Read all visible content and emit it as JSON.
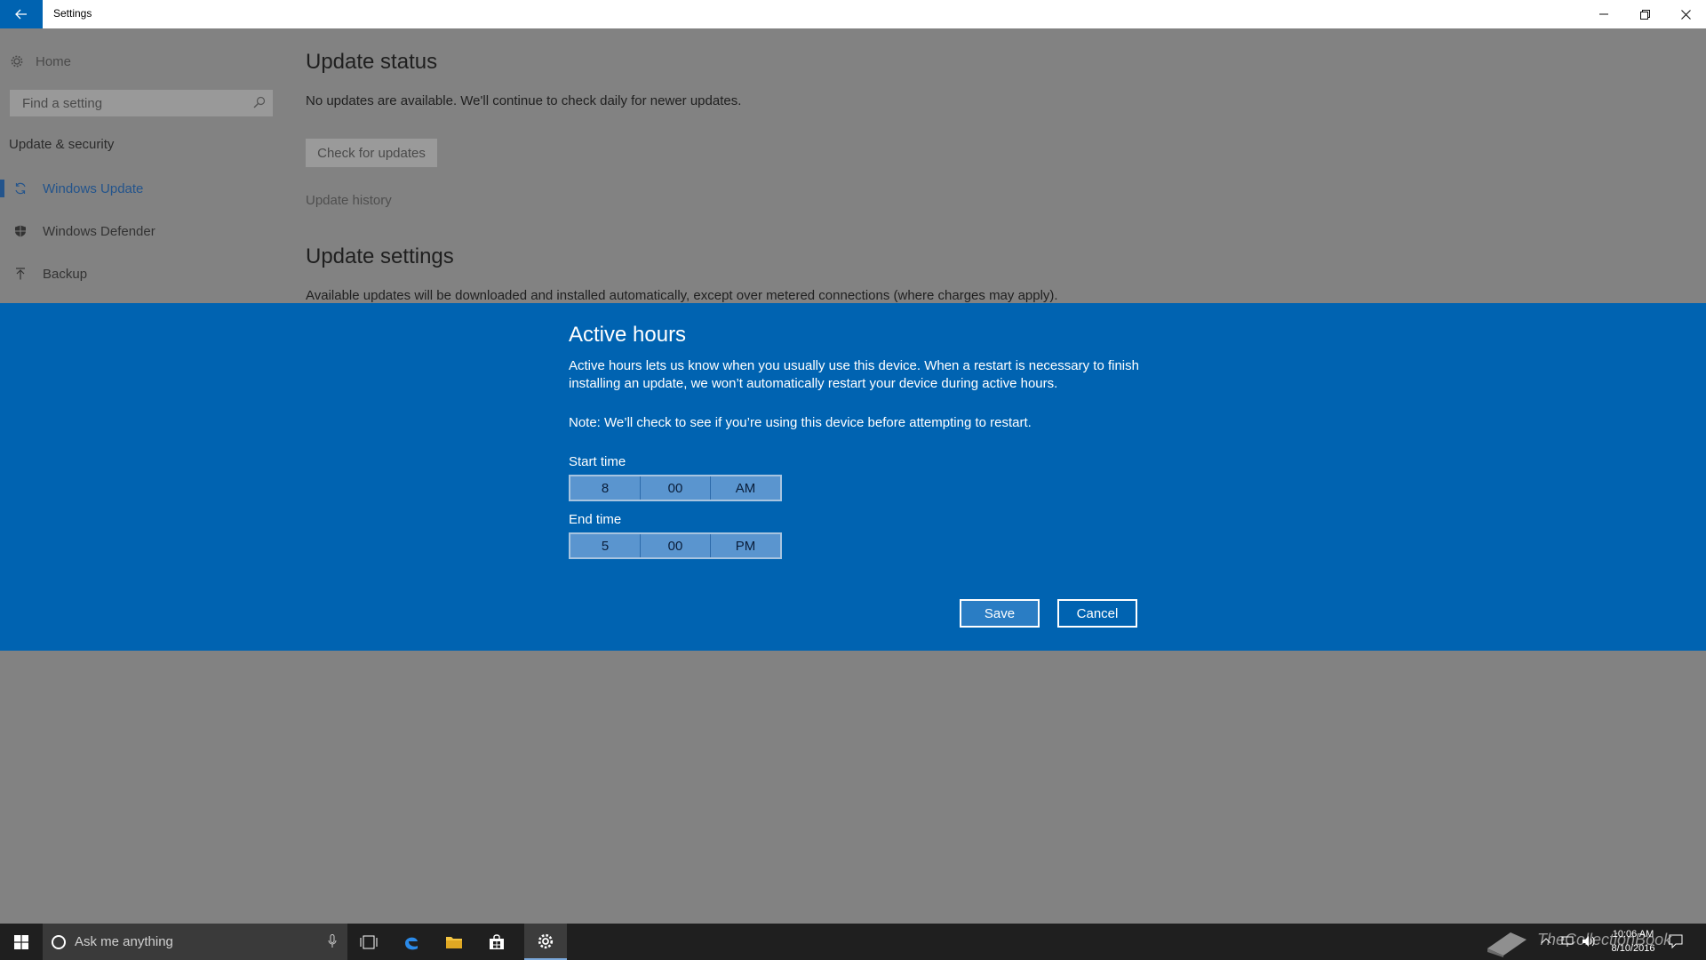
{
  "window": {
    "title": "Settings"
  },
  "sidebar": {
    "home_label": "Home",
    "search_placeholder": "Find a setting",
    "section_title": "Update & security",
    "items": [
      {
        "label": "Windows Update",
        "icon": "sync-icon",
        "active": true
      },
      {
        "label": "Windows Defender",
        "icon": "shield-icon",
        "active": false
      },
      {
        "label": "Backup",
        "icon": "upload-icon",
        "active": false
      }
    ]
  },
  "main": {
    "update_status_title": "Update status",
    "update_status_text": "No updates are available. We'll continue to check daily for newer updates.",
    "check_button": "Check for updates",
    "update_history_link": "Update history",
    "update_settings_title": "Update settings",
    "update_settings_text": "Available updates will be downloaded and installed automatically, except over metered connections (where charges may apply)."
  },
  "dialog": {
    "title": "Active hours",
    "description": "Active hours lets us know when you usually use this device. When a restart is necessary to finish installing an update, we won’t automatically restart your device during active hours.",
    "note": "Note: We’ll check to see if you’re using this device before attempting to restart.",
    "start_label": "Start time",
    "start_time": {
      "hour": "8",
      "minute": "00",
      "period": "AM"
    },
    "end_label": "End time",
    "end_time": {
      "hour": "5",
      "minute": "00",
      "period": "PM"
    },
    "save_label": "Save",
    "cancel_label": "Cancel",
    "accent_color": "#0063b1"
  },
  "taskbar": {
    "search_placeholder": "Ask me anything",
    "time": "10:06 AM",
    "date": "8/10/2016",
    "watermark": "TheCollectionBook"
  }
}
